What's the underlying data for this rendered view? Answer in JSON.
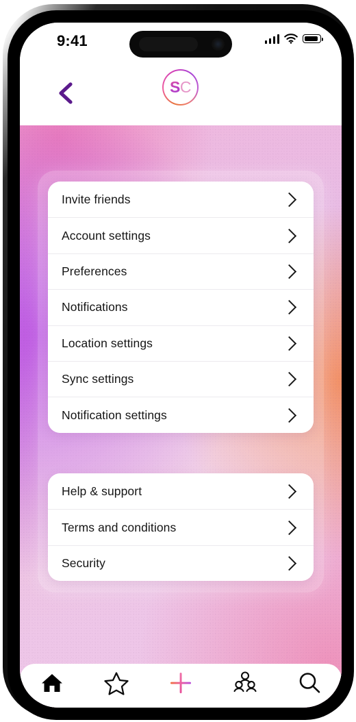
{
  "device": {
    "status_bar": {
      "time": "9:41",
      "signal_icon": "cellular-signal-icon",
      "wifi_icon": "wifi-icon",
      "battery_icon": "battery-icon",
      "battery_level": 80
    },
    "dynamic_island": "dynamic-island"
  },
  "header": {
    "back_icon": "back-chevron-icon",
    "back_color": "#5b1a8c",
    "logo": {
      "name": "brand-logo",
      "text_primary": "S",
      "text_secondary": "C",
      "ring_colors": [
        "#e8743c",
        "#ef5fa0",
        "#d13fb8",
        "#a945d6"
      ]
    }
  },
  "theme": {
    "background_gradient": [
      "#ba50e2",
      "#f38d5c",
      "#ee78b2",
      "#edc5e6"
    ],
    "card_background": "#ffffff",
    "text_color": "#151515",
    "accent_purple": "#5b1a8c",
    "accent_pink": "#e3529f"
  },
  "main": {
    "groups": [
      {
        "id": "settings-group",
        "items": [
          {
            "label": "Invite friends",
            "chevron": "chevron-right-icon"
          },
          {
            "label": "Account settings",
            "chevron": "chevron-right-icon"
          },
          {
            "label": "Preferences",
            "chevron": "chevron-right-icon"
          },
          {
            "label": "Notifications",
            "chevron": "chevron-right-icon"
          },
          {
            "label": "Location settings",
            "chevron": "chevron-right-icon"
          },
          {
            "label": "Sync settings",
            "chevron": "chevron-right-icon"
          },
          {
            "label": "Notification settings",
            "chevron": "chevron-right-icon"
          }
        ]
      },
      {
        "id": "support-group",
        "items": [
          {
            "label": "Help & support",
            "chevron": "chevron-right-icon"
          },
          {
            "label": "Terms and conditions",
            "chevron": "chevron-right-icon"
          },
          {
            "label": "Security",
            "chevron": "chevron-right-icon"
          }
        ]
      }
    ]
  },
  "bottom_nav": {
    "items": [
      {
        "name": "nav-home",
        "icon": "home-icon",
        "active": true
      },
      {
        "name": "nav-favorites",
        "icon": "star-icon",
        "active": false
      },
      {
        "name": "nav-create",
        "icon": "plus-icon",
        "active": false
      },
      {
        "name": "nav-groups",
        "icon": "people-group-icon",
        "active": false
      },
      {
        "name": "nav-search",
        "icon": "search-icon",
        "active": false
      }
    ],
    "plus_gradient": [
      "#f0703f",
      "#ec5d9c",
      "#b84ddc"
    ]
  }
}
